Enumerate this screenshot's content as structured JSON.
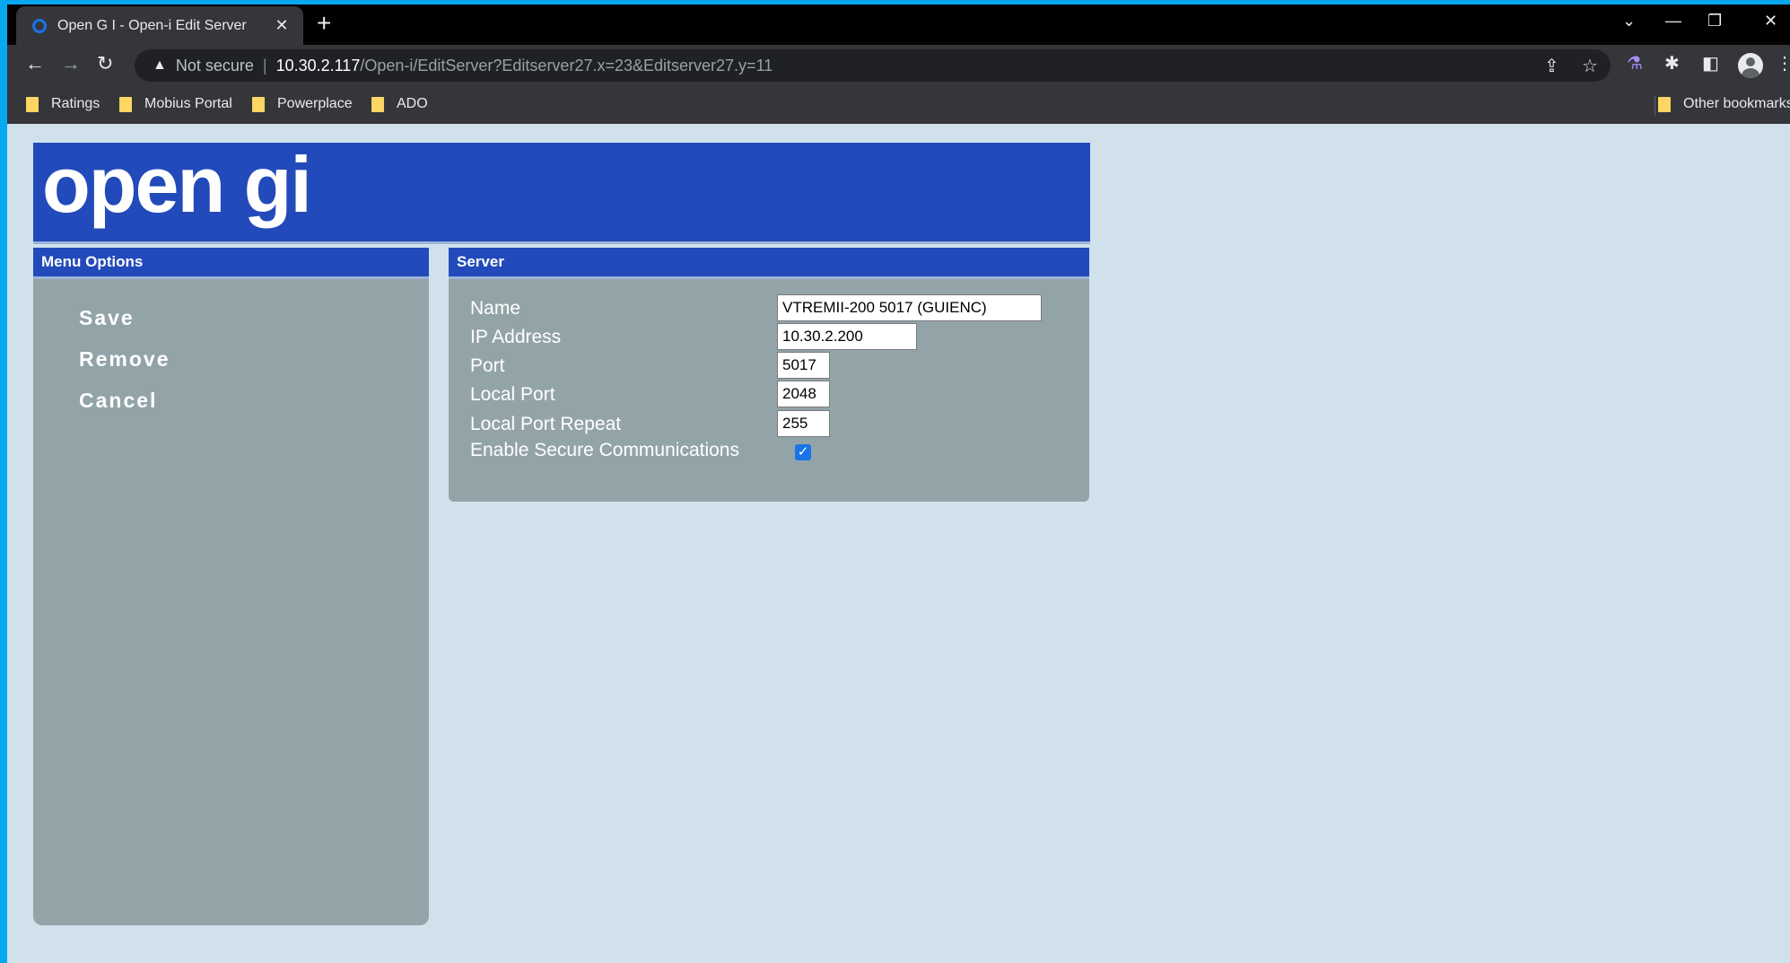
{
  "browser": {
    "tab_title": "Open G I - Open-i Edit Server",
    "tab_close": "✕",
    "new_tab": "+",
    "security_label": "Not secure",
    "url_separator": "|",
    "url_host": "10.30.2.117",
    "url_path": "/Open-i/EditServer?Editserver27.x=23&Editserver27.y=11",
    "bookmarks": [
      "Ratings",
      "Mobius Portal",
      "Powerplace",
      "ADO"
    ],
    "other_bookmarks": "Other bookmarks"
  },
  "logo_text": "open gi",
  "menu": {
    "header": "Menu Options",
    "items": [
      "Save",
      "Remove",
      "Cancel"
    ]
  },
  "server": {
    "header": "Server",
    "fields": [
      {
        "label": "Name",
        "value": "VTREMII-200 5017 (GUIENC)"
      },
      {
        "label": "IP Address",
        "value": "10.30.2.200"
      },
      {
        "label": "Port",
        "value": "5017"
      },
      {
        "label": "Local Port",
        "value": "2048"
      },
      {
        "label": "Local Port Repeat",
        "value": "255"
      }
    ],
    "secure_label": "Enable Secure Communications",
    "secure_checked": true
  },
  "colors": {
    "brand_blue": "#234aba",
    "panel_gray": "#93a4a9",
    "page_background": "#d0e1ec"
  }
}
